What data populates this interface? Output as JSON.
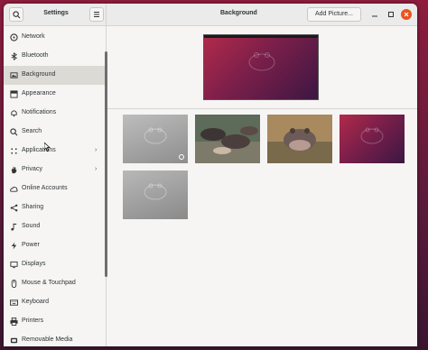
{
  "titlebar": {
    "app_title": "Settings",
    "panel_title": "Background",
    "add_picture_label": "Add Picture..."
  },
  "sidebar": {
    "items": [
      {
        "label": "Network",
        "icon": "network-icon"
      },
      {
        "label": "Bluetooth",
        "icon": "bluetooth-icon"
      },
      {
        "label": "Background",
        "icon": "background-icon",
        "active": true
      },
      {
        "label": "Appearance",
        "icon": "appearance-icon"
      },
      {
        "label": "Notifications",
        "icon": "bell-icon"
      },
      {
        "label": "Search",
        "icon": "search-icon"
      },
      {
        "label": "Applications",
        "icon": "grid-icon",
        "chevron": true
      },
      {
        "label": "Privacy",
        "icon": "hand-icon",
        "chevron": true
      },
      {
        "label": "Online Accounts",
        "icon": "cloud-icon"
      },
      {
        "label": "Sharing",
        "icon": "share-icon"
      },
      {
        "label": "Sound",
        "icon": "music-note-icon"
      },
      {
        "label": "Power",
        "icon": "power-icon"
      },
      {
        "label": "Displays",
        "icon": "display-icon"
      },
      {
        "label": "Mouse & Touchpad",
        "icon": "mouse-icon"
      },
      {
        "label": "Keyboard",
        "icon": "keyboard-icon"
      },
      {
        "label": "Printers",
        "icon": "printer-icon"
      },
      {
        "label": "Removable Media",
        "icon": "media-icon"
      }
    ]
  },
  "colors": {
    "accent": "#e95420",
    "wallpaper_purple": "#7a1f4a"
  }
}
